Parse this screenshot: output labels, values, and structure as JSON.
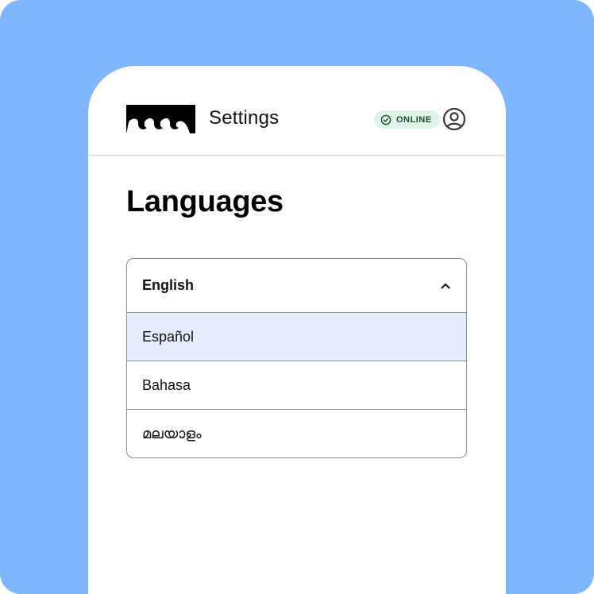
{
  "header": {
    "title": "Settings",
    "logo_icon": "wave-logo-icon",
    "status": {
      "label": "ONLINE",
      "icon": "check-circle-icon",
      "background": "#dff3e6",
      "color": "#1d4d2e"
    },
    "avatar_icon": "user-circle-icon"
  },
  "page": {
    "title": "Languages"
  },
  "language_select": {
    "selected": "English",
    "expanded": true,
    "toggle_icon": "chevron-up-icon",
    "options": [
      {
        "label": "Español",
        "highlighted": true
      },
      {
        "label": "Bahasa",
        "highlighted": false
      },
      {
        "label": "മലയാളം",
        "highlighted": false
      }
    ]
  },
  "colors": {
    "background": "#7fb6fc",
    "card": "#ffffff",
    "highlight": "#e5edfd",
    "text": "#111111"
  }
}
